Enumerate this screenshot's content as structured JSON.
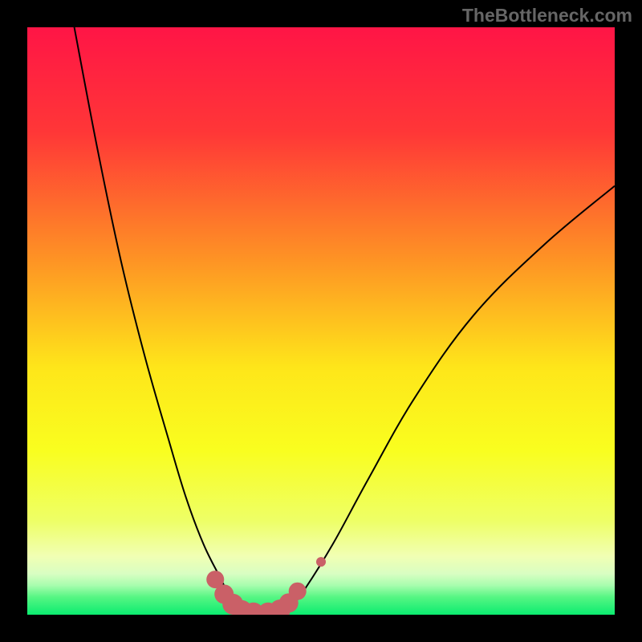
{
  "watermark": "TheBottleneck.com",
  "chart_data": {
    "type": "line",
    "title": "",
    "xlabel": "",
    "ylabel": "",
    "xlim": [
      0,
      100
    ],
    "ylim": [
      0,
      100
    ],
    "gradient_stops": [
      {
        "offset": 0,
        "color": "#FF1546"
      },
      {
        "offset": 18,
        "color": "#FF3737"
      },
      {
        "offset": 40,
        "color": "#FE9524"
      },
      {
        "offset": 58,
        "color": "#FEE61A"
      },
      {
        "offset": 72,
        "color": "#F9FE1F"
      },
      {
        "offset": 84,
        "color": "#EEFF66"
      },
      {
        "offset": 90,
        "color": "#F1FFB3"
      },
      {
        "offset": 93,
        "color": "#D9FEC2"
      },
      {
        "offset": 95,
        "color": "#A8FDAE"
      },
      {
        "offset": 97,
        "color": "#56F683"
      },
      {
        "offset": 100,
        "color": "#0BEC70"
      }
    ],
    "series": [
      {
        "name": "left-curve",
        "x": [
          8.0,
          12.0,
          16.0,
          20.0,
          24.0,
          27.0,
          30.0,
          33.0,
          35.0,
          36.5
        ],
        "y": [
          100.0,
          79.0,
          60.0,
          44.0,
          30.0,
          20.0,
          12.0,
          6.0,
          2.0,
          0.2
        ]
      },
      {
        "name": "right-curve",
        "x": [
          44.0,
          47.0,
          52.0,
          58.0,
          66.0,
          76.0,
          88.0,
          100.0
        ],
        "y": [
          0.2,
          4.0,
          12.0,
          23.0,
          37.0,
          51.0,
          63.0,
          73.0
        ]
      }
    ],
    "highlight_markers": {
      "name": "bottom-markers",
      "color": "#CA6067",
      "points_x": [
        32.0,
        33.5,
        35.0,
        36.5,
        38.5,
        41.0,
        43.0,
        44.5,
        46.0,
        50.0
      ],
      "points_y": [
        6.0,
        3.5,
        1.8,
        0.7,
        0.3,
        0.3,
        0.8,
        2.0,
        4.0,
        9.0
      ],
      "sizes": [
        11,
        12,
        13,
        13,
        13,
        13,
        13,
        12,
        11,
        6
      ]
    }
  }
}
